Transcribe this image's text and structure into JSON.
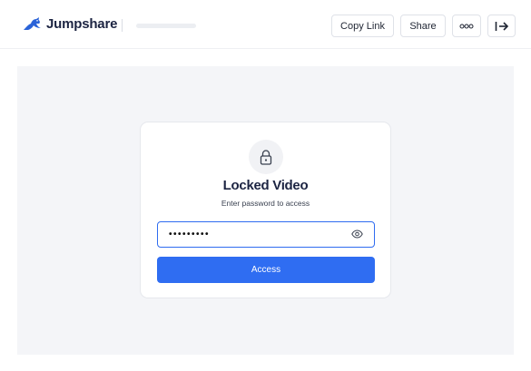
{
  "header": {
    "brand_name": "Jumpshare",
    "copy_link_label": "Copy Link",
    "share_label": "Share"
  },
  "locked": {
    "title": "Locked Video",
    "subtitle": "Enter password to access",
    "password_mask": "•••••••••",
    "access_label": "Access"
  },
  "icons": {
    "brand": "kangaroo-logo-icon",
    "more": "more-dots-icon",
    "exit": "exit-arrow-icon",
    "lock": "lock-icon",
    "show_password": "eye-icon"
  },
  "colors": {
    "accent": "#2f6df2",
    "brand_blue": "#2a63d8",
    "stage_bg": "#f4f5f8"
  }
}
